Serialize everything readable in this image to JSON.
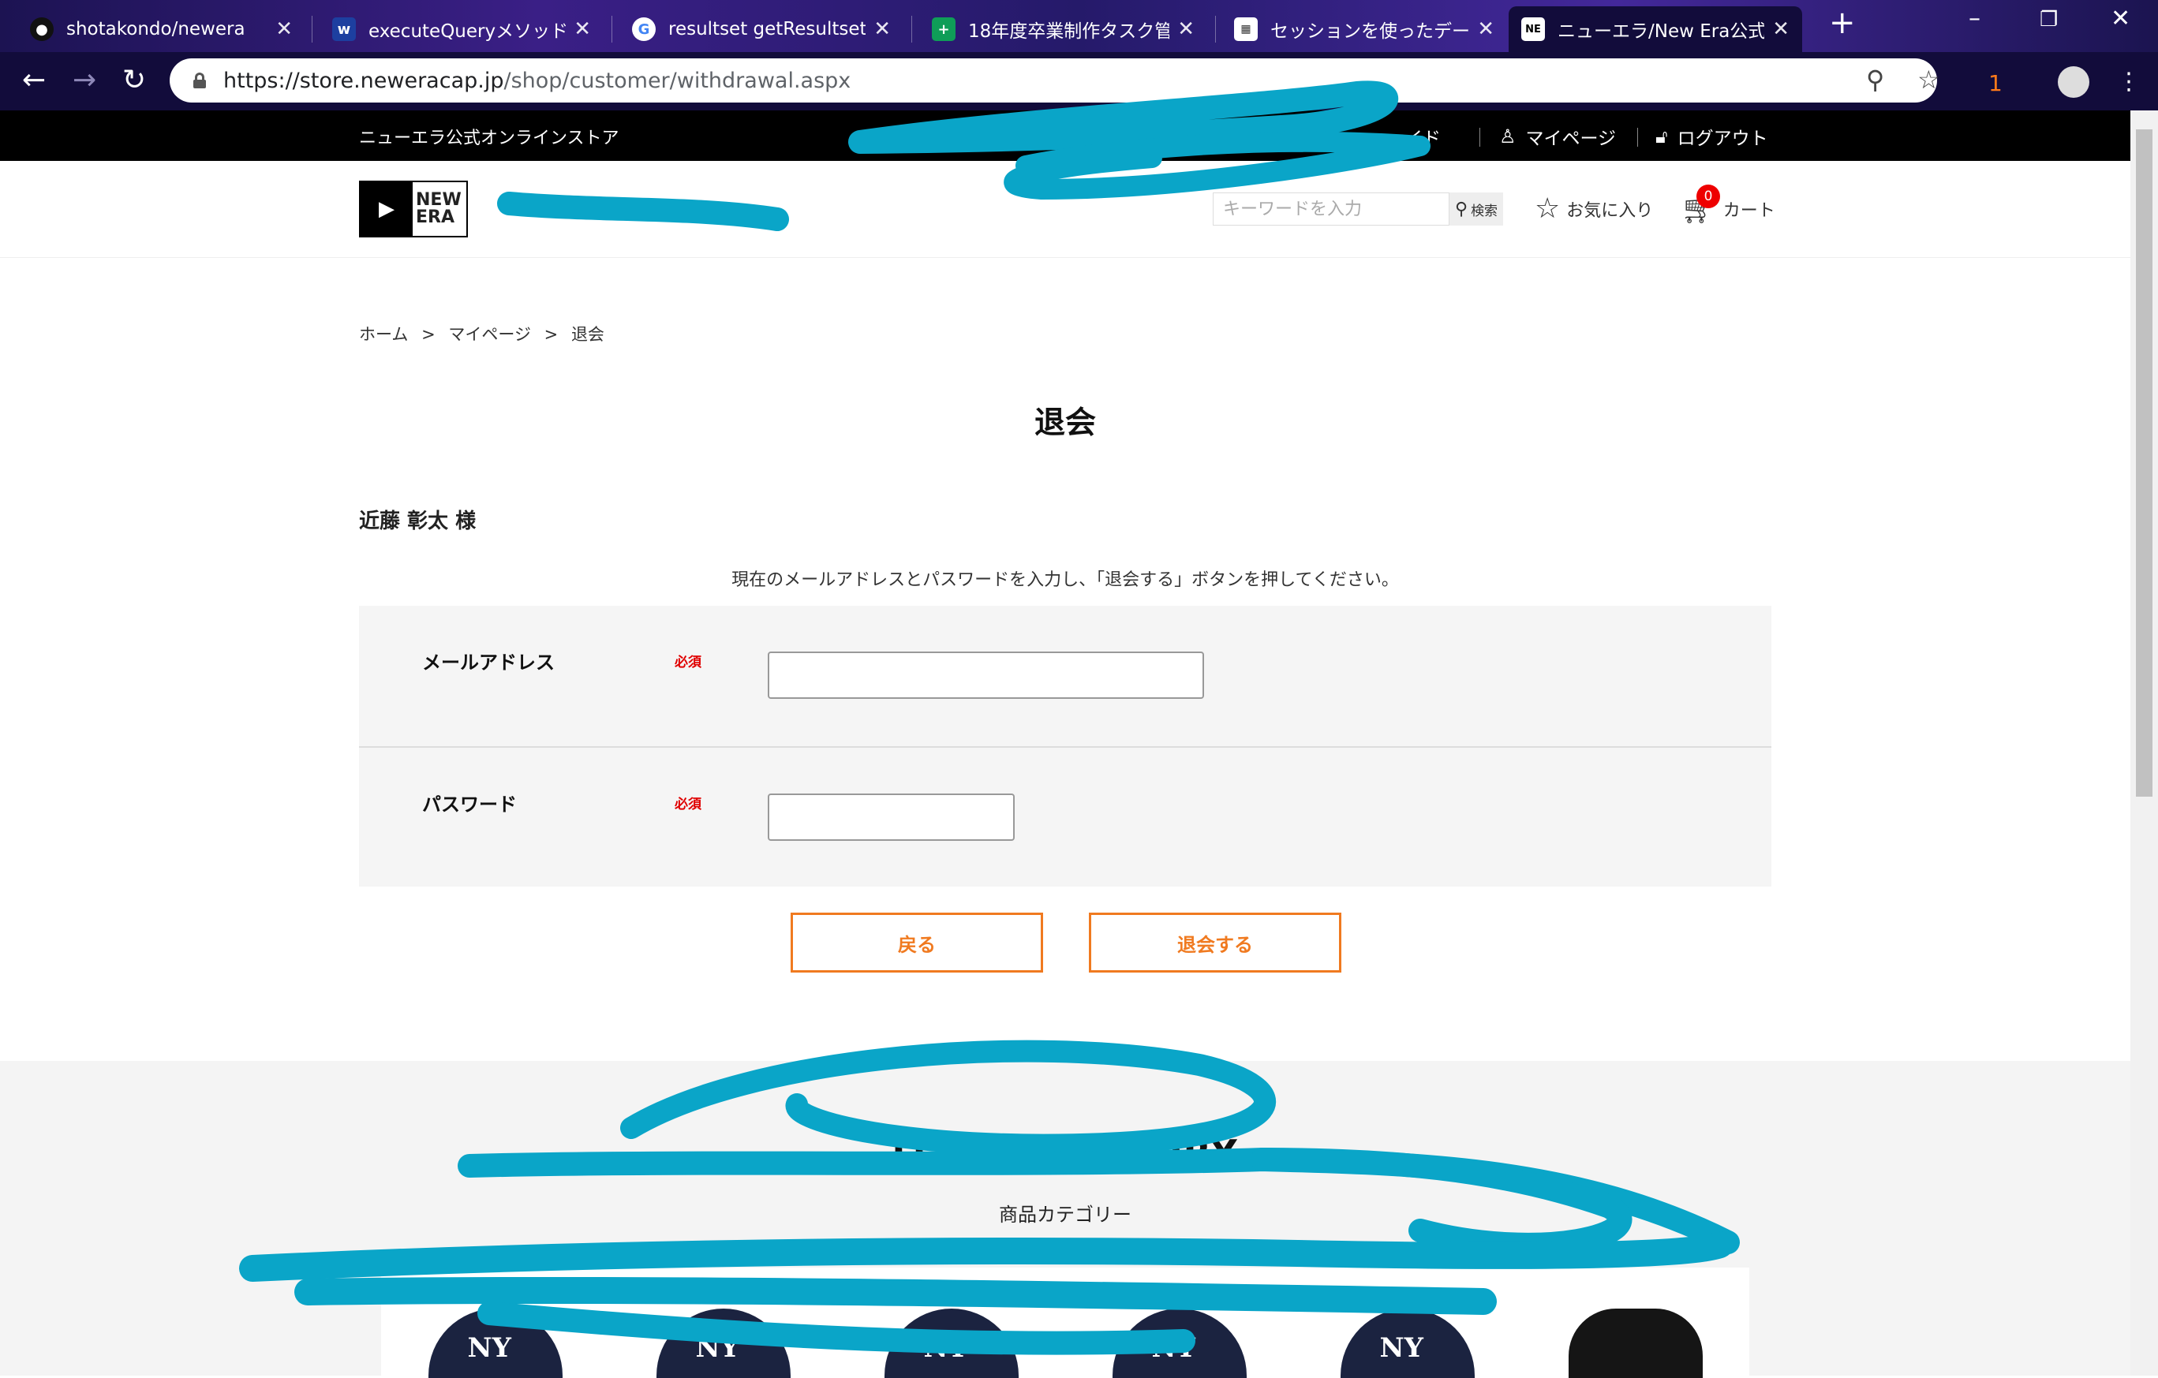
{
  "browser": {
    "tabs": [
      {
        "title": "shotakondo/newera",
        "icon": "github-icon",
        "active": false
      },
      {
        "title": "executeQueryメソッド | Ja",
        "icon": "site-icon",
        "active": false
      },
      {
        "title": "resultset getResultset -",
        "icon": "google-icon",
        "active": false
      },
      {
        "title": "18年度卒業制作タスク管",
        "icon": "sheets-icon",
        "active": false
      },
      {
        "title": "セッションを使ったデータの",
        "icon": "grid-icon",
        "active": false
      },
      {
        "title": "ニューエラ/New Era公式オ",
        "icon": "newera-icon",
        "active": true
      }
    ],
    "url_host": "https://store.neweracap.jp",
    "url_path": "/shop/customer/withdrawal.aspx",
    "extension_badge": "1",
    "colors": {
      "tabstrip": "#2a1b6e",
      "toolbar": "#120c3b"
    }
  },
  "site": {
    "store_name": "ニューエラ公式オンラインストア",
    "guide_link": "イド",
    "mypage_link": "マイページ",
    "logout_link": "ログアウト",
    "logo_top": "NEW",
    "logo_bottom": "ERA",
    "search_placeholder": "キーワードを入力",
    "search_button": "検索",
    "favorites_link": "お気に入り",
    "cart_link": "カート",
    "cart_count": "0"
  },
  "breadcrumb": [
    {
      "label": "ホーム"
    },
    {
      "label": ">"
    },
    {
      "label": "マイページ"
    },
    {
      "label": ">"
    },
    {
      "label": "退会"
    }
  ],
  "page": {
    "title": "退会",
    "user_name": "近藤 彰太 様",
    "instruction": "現在のメールアドレスとパスワードを入力し、「退会する」ボタンを押してください。",
    "fields": [
      {
        "label": "メールアドレス",
        "required": "必須",
        "value": ""
      },
      {
        "label": "パスワード",
        "required": "必須",
        "value": ""
      }
    ],
    "back_button": "戻る",
    "withdraw_button": "退会する",
    "accent_color": "#f07a20",
    "required_color": "#e00000"
  },
  "category": {
    "heading_en": "ITEM CATEGORY",
    "heading_jp": "商品カテゴリー"
  }
}
